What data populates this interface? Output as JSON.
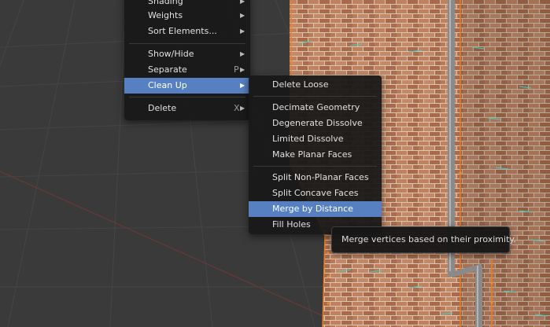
{
  "viewport": {
    "background": "#3a3a3a",
    "grid_color": "#454545",
    "mesh_edge_color": "#f07a1e",
    "brick_color": "#b47452"
  },
  "parent_menu": {
    "items": [
      {
        "label": "Shading",
        "has_submenu": true
      },
      {
        "label": "Weights",
        "has_submenu": true
      },
      {
        "label": "Sort Elements...",
        "has_submenu": true
      },
      {
        "label": "Show/Hide",
        "has_submenu": true
      },
      {
        "label": "Separate",
        "shortcut": "P",
        "has_submenu": true
      },
      {
        "label": "Clean Up",
        "has_submenu": true,
        "active": true
      },
      {
        "label": "Delete",
        "shortcut": "X",
        "has_submenu": true
      }
    ]
  },
  "cleanup_menu": {
    "items": [
      {
        "label": "Delete Loose"
      },
      {
        "label": "Decimate Geometry"
      },
      {
        "label": "Degenerate Dissolve"
      },
      {
        "label": "Limited Dissolve"
      },
      {
        "label": "Make Planar Faces"
      },
      {
        "label": "Split Non-Planar Faces"
      },
      {
        "label": "Split Concave Faces"
      },
      {
        "label": "Merge by Distance",
        "active": true
      },
      {
        "label": "Fill Holes"
      }
    ]
  },
  "tooltip": {
    "text": "Merge vertices based on their proximity."
  },
  "colors": {
    "menu_bg": "#181818",
    "highlight": "#5680c2",
    "text": "#e0e0e0"
  }
}
